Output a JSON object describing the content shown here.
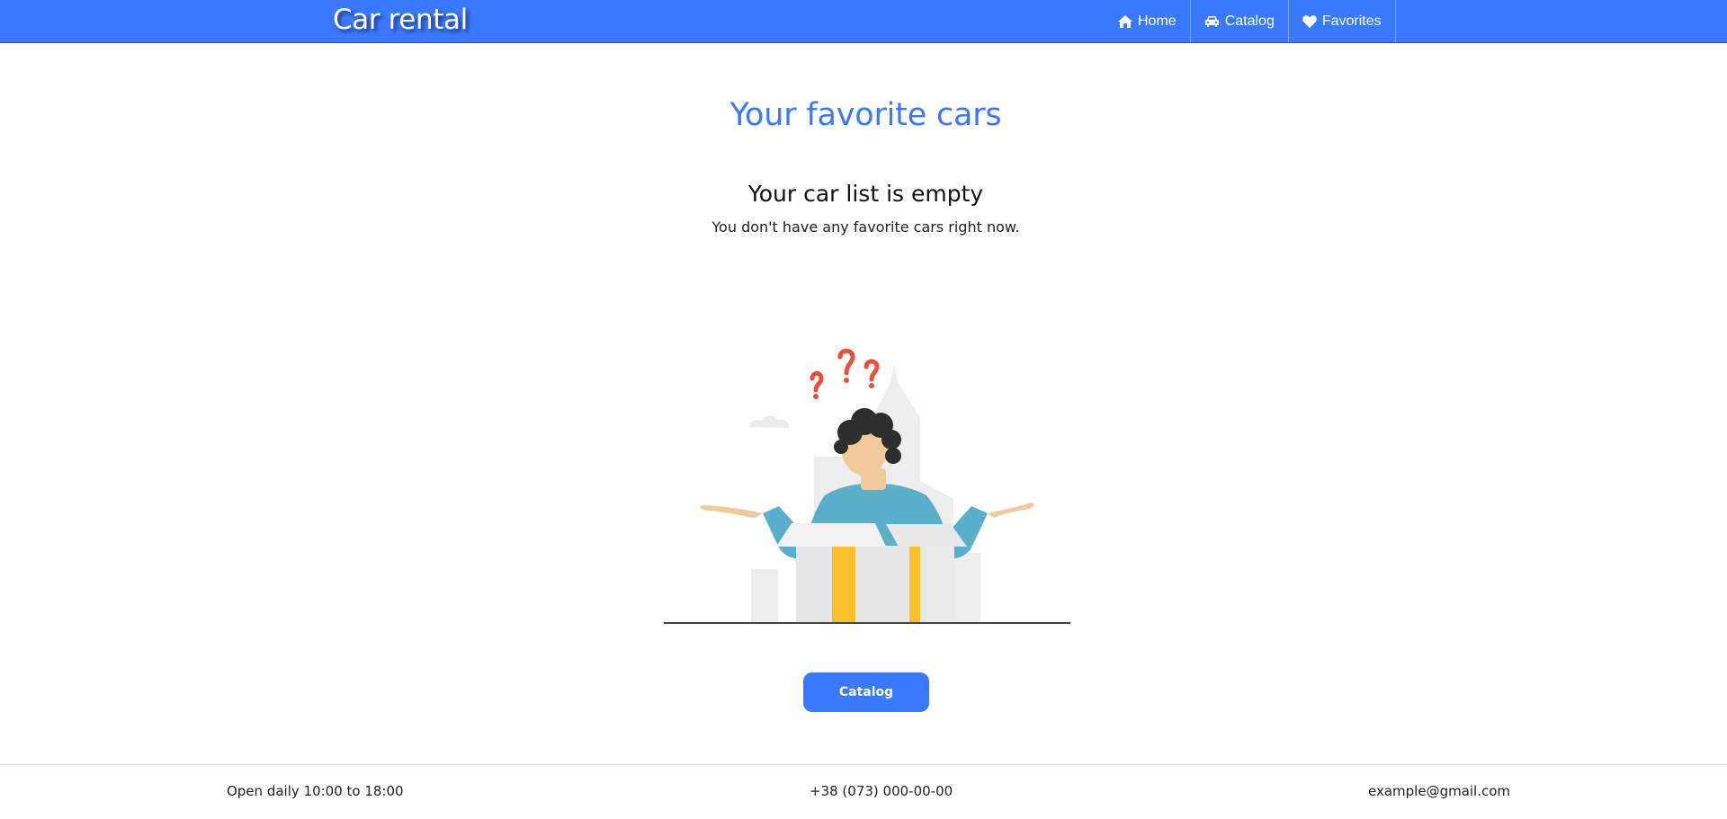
{
  "header": {
    "brand": "Car rental",
    "nav": [
      {
        "label": "Home",
        "icon": "home-icon"
      },
      {
        "label": "Catalog",
        "icon": "car-icon"
      },
      {
        "label": "Favorites",
        "icon": "heart-icon"
      }
    ]
  },
  "main": {
    "title": "Your favorite cars",
    "empty_heading": "Your car list is empty",
    "empty_text": "You don't have any favorite cars right now.",
    "catalog_button": "Catalog",
    "illustration": "confused-person-illustration"
  },
  "footer": {
    "hours": "Open daily 10:00 to 18:00",
    "phone": "+38 (073) 000-00-00",
    "email": "example@gmail.com"
  },
  "colors": {
    "accent": "#3a78fe",
    "question_marks": "#ea4e3d",
    "shirt": "#5aafca",
    "skin": "#f2c99a",
    "hair": "#2e2e2e",
    "box_stripe": "#f8c12b"
  }
}
